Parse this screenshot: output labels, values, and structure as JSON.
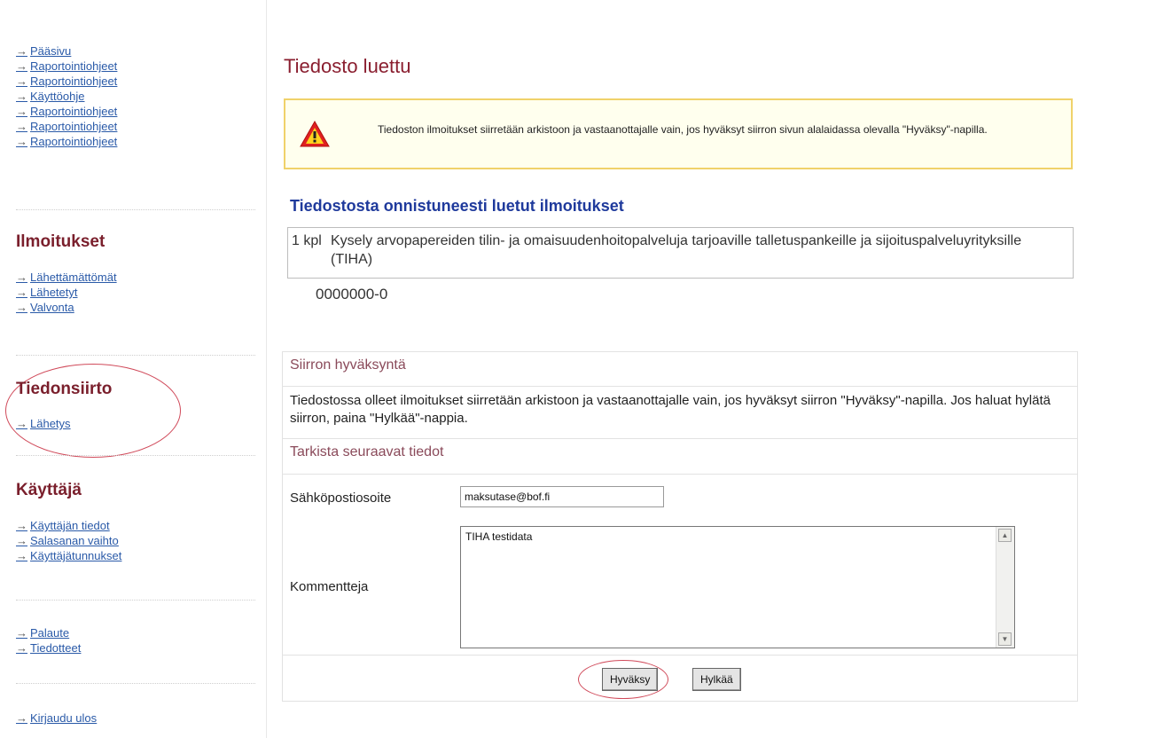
{
  "sidebar": {
    "top_links": [
      {
        "arrow": "→",
        "label": "Pääsivu"
      },
      {
        "arrow": "→",
        "label": "Raportointiohjeet"
      },
      {
        "arrow": "→",
        "label": "Raportointiohjeet"
      },
      {
        "arrow": "→",
        "label": "Käyttöohje"
      },
      {
        "arrow": "→",
        "label": "Raportointiohjeet"
      },
      {
        "arrow": "→",
        "label": "Raportointiohjeet"
      },
      {
        "arrow": "→",
        "label": "Raportointiohjeet"
      }
    ],
    "ilmoitukset": {
      "heading": "Ilmoitukset",
      "links": [
        {
          "arrow": "→",
          "label": "Lähettämättömät"
        },
        {
          "arrow": "→",
          "label": "Lähetetyt"
        },
        {
          "arrow": "→",
          "label": "Valvonta"
        }
      ]
    },
    "tiedonsiirto": {
      "heading": "Tiedonsiirto",
      "links": [
        {
          "arrow": "→",
          "label": "Lähetys"
        }
      ]
    },
    "kayttaja": {
      "heading": "Käyttäjä",
      "links": [
        {
          "arrow": "→",
          "label": "Käyttäjän tiedot"
        },
        {
          "arrow": "→",
          "label": "Salasanan vaihto"
        },
        {
          "arrow": "→",
          "label": "Käyttäjätunnukset"
        }
      ]
    },
    "misc_links": [
      {
        "arrow": "→",
        "label": "Palaute"
      },
      {
        "arrow": "→",
        "label": "Tiedotteet"
      }
    ],
    "logout": {
      "arrow": "→",
      "label": "Kirjaudu ulos"
    }
  },
  "main": {
    "title": "Tiedosto luettu",
    "warning": "Tiedoston ilmoitukset siirretään arkistoon ja vastaanottajalle vain, jos hyväksyt siirron sivun alalaidassa olevalla \"Hyväksy\"-napilla.",
    "subtitle": "Tiedostosta onnistuneesti luetut ilmoitukset",
    "file": {
      "count": "1 kpl",
      "name": "Kysely arvopapereiden tilin- ja omaisuudenhoitopalveluja tarjoaville talletuspankeille ja sijoituspalveluyrityksille (TIHA)",
      "id": "0000000-0"
    },
    "approval": {
      "heading": "Siirron hyväksyntä",
      "info": "Tiedostossa olleet ilmoitukset siirretään arkistoon ja vastaanottajalle vain, jos hyväksyt siirron \"Hyväksy\"-napilla. Jos haluat hylätä siirron, paina \"Hylkää\"-nappia.",
      "check_heading": "Tarkista seuraavat tiedot",
      "email_label": "Sähköpostiosoite",
      "email_value": "maksutase@bof.fi",
      "comment_label": "Kommentteja",
      "comment_value": "TIHA testidata",
      "accept_label": "Hyväksy",
      "reject_label": "Hylkää"
    }
  },
  "colors": {
    "heading_red": "#7a1f2c",
    "link_blue": "#2a5aa8",
    "subtitle_blue": "#1f3a9c",
    "warn_border": "#f0d26a",
    "highlight_ellipse": "#d04a5a"
  },
  "icons": {
    "warning": "warning-triangle-icon",
    "nav_arrow": "arrow-right-icon"
  }
}
